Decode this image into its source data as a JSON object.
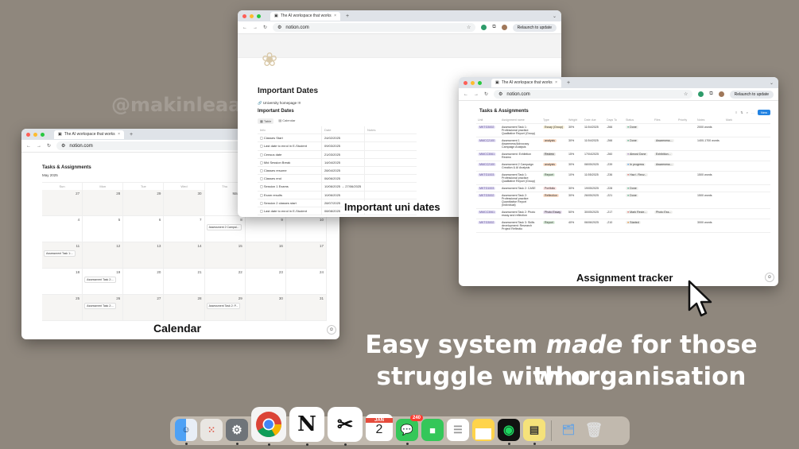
{
  "watermark": "@makinleaa",
  "browser": {
    "tab_title": "The AI workspace that works",
    "url": "notion.com",
    "relaunch": "Relaunch to update"
  },
  "calendar": {
    "title": "Tasks & Assignments",
    "month": "May 2025",
    "days": [
      "Sun",
      "Mon",
      "Tue",
      "Wed",
      "Thu",
      "Fri",
      "Sat"
    ],
    "cells": [
      {
        "n": "27",
        "dim": true,
        "ev": ""
      },
      {
        "n": "28",
        "dim": true,
        "ev": ""
      },
      {
        "n": "29",
        "dim": true,
        "ev": ""
      },
      {
        "n": "30",
        "dim": true,
        "ev": ""
      },
      {
        "n": "May 1",
        "dim": false,
        "ev": ""
      },
      {
        "n": "2",
        "dim": false,
        "ev": ""
      },
      {
        "n": "3",
        "dim": false,
        "ev": ""
      },
      {
        "n": "4",
        "dim": false,
        "ev": ""
      },
      {
        "n": "5",
        "dim": false,
        "ev": ""
      },
      {
        "n": "6",
        "dim": false,
        "ev": ""
      },
      {
        "n": "7",
        "dim": false,
        "ev": ""
      },
      {
        "n": "8",
        "dim": false,
        "ev": "Assessment 2 Campai..."
      },
      {
        "n": "9",
        "dim": false,
        "ev": ""
      },
      {
        "n": "10",
        "dim": false,
        "ev": ""
      },
      {
        "n": "11",
        "dim": true,
        "ev": "Assessment Task 1:..."
      },
      {
        "n": "12",
        "dim": true,
        "ev": ""
      },
      {
        "n": "13",
        "dim": true,
        "ev": ""
      },
      {
        "n": "14",
        "dim": true,
        "ev": ""
      },
      {
        "n": "15",
        "dim": true,
        "ev": ""
      },
      {
        "n": "16",
        "dim": true,
        "ev": ""
      },
      {
        "n": "17",
        "dim": true,
        "ev": ""
      },
      {
        "n": "18",
        "dim": false,
        "ev": ""
      },
      {
        "n": "19",
        "dim": false,
        "ev": "Assessment Task 2:..."
      },
      {
        "n": "20",
        "dim": false,
        "ev": ""
      },
      {
        "n": "21",
        "dim": false,
        "ev": ""
      },
      {
        "n": "22",
        "dim": false,
        "ev": ""
      },
      {
        "n": "23",
        "dim": false,
        "ev": ""
      },
      {
        "n": "24",
        "dim": false,
        "ev": ""
      },
      {
        "n": "25",
        "dim": true,
        "ev": ""
      },
      {
        "n": "26",
        "dim": true,
        "ev": "Assessment Task 2:..."
      },
      {
        "n": "27",
        "dim": true,
        "ev": ""
      },
      {
        "n": "28",
        "dim": true,
        "ev": ""
      },
      {
        "n": "29",
        "dim": true,
        "ev": "Assessment Task 2: P..."
      },
      {
        "n": "30",
        "dim": true,
        "ev": ""
      },
      {
        "n": "31",
        "dim": true,
        "ev": ""
      }
    ],
    "caption": "Calendar"
  },
  "dates": {
    "title": "Important Dates",
    "link": "University homepage !!!",
    "subtitle": "Important Dates",
    "tabs": [
      "Table",
      "Calendar"
    ],
    "columns": [
      "Info",
      "Date",
      "Notes"
    ],
    "rows": [
      [
        "Classes Start",
        "24/02/2025"
      ],
      [
        "Last date to enrol in E-Student",
        "09/03/2025"
      ],
      [
        "Census date",
        "21/03/2025"
      ],
      [
        "Mid Session Break",
        "14/04/2025"
      ],
      [
        "Classes resume",
        "28/04/2025"
      ],
      [
        "Classes end",
        "06/06/2025"
      ],
      [
        "Session 1 Exams",
        "10/06/2025 → 27/06/2025"
      ],
      [
        "Exam results",
        "10/06/2025"
      ],
      [
        "Session 2 classes start",
        "28/07/2025"
      ],
      [
        "Last date to enrol in E-Student",
        "08/08/2025"
      ]
    ],
    "caption": "Important uni dates"
  },
  "tasks": {
    "title": "Tasks & Assignments",
    "new_label": "New",
    "columns": [
      "Unit",
      "Assignment name",
      "Type",
      "Weight",
      "Date due",
      "Days To",
      "Status",
      "Files",
      "Priority",
      "Notes",
      "Mark"
    ],
    "rows": [
      {
        "unit": "MKTG3002",
        "name": "Assessment Task 1: Professional practice: Qualitative Report (Group)",
        "type": "Essay (Group)",
        "weight": "30%",
        "due": "11/04/2025",
        "days": "-266",
        "status": "Done",
        "files": "",
        "notes": "2000 words"
      },
      {
        "unit": "MMCC2100",
        "name": "Assessment 1 Awareness/Advocacy Campaign Analysis",
        "type": "analysis",
        "weight": "30%",
        "due": "11/04/2025",
        "days": "-266",
        "status": "Done",
        "files": "Awareness...",
        "notes": "1400-1700 words"
      },
      {
        "unit": "MMCC3061",
        "name": "Assessment: Exhibition Review",
        "type": "Review",
        "weight": "15%",
        "due": "17/04/2025",
        "days": "-260",
        "status": "Almost Done",
        "files": "Exhibition...",
        "notes": ""
      },
      {
        "unit": "MMCC2100",
        "name": "Assessment 2 Campaign Creation & AI Analysis",
        "type": "analysis",
        "weight": "30%",
        "due": "08/05/2025",
        "days": "-239",
        "status": "In progress",
        "files": "Awareness...",
        "notes": ""
      },
      {
        "unit": "MKTG1003",
        "name": "Assessment Task 1: Professional practice: Qualitative Report (Group)",
        "type": "Report",
        "weight": "10%",
        "due": "11/05/2025",
        "days": "-236",
        "status": "Hav i. Recv...",
        "files": "",
        "notes": "1500 words"
      },
      {
        "unit": "MKTG1003",
        "name": "Assessment Task 2: CASE",
        "type": "Portfolio",
        "weight": "30%",
        "due": "19/05/2025",
        "days": "-228",
        "status": "Done",
        "files": "",
        "notes": ""
      },
      {
        "unit": "MKTG3002",
        "name": "Assessment Task 2: Professional practice: Quantitative Report (Individual)",
        "type": "Reflection",
        "weight": "30%",
        "due": "26/05/2025",
        "days": "-221",
        "status": "Done",
        "files": "",
        "notes": "1500 words"
      },
      {
        "unit": "MMCC3061",
        "name": "Assessment Task 2: Photo essay and reflection",
        "type": "Photo Essay",
        "weight": "50%",
        "due": "30/05/2025",
        "days": "-217",
        "status": "Mark Recie...",
        "files": "Photo Ess...",
        "notes": ""
      },
      {
        "unit": "MKTG3002",
        "name": "Assessment Task 3: Skills development: Research Project Reflectio",
        "type": "Report",
        "weight": "40%",
        "due": "06/06/2025",
        "days": "-210",
        "status": "Started",
        "files": "",
        "notes": "3000 words"
      }
    ],
    "caption": "Assignment tracker"
  },
  "headline": {
    "line1_a": "Easy system ",
    "line1_em": "made",
    "line1_b": " for those who",
    "line2": "struggle with organisation"
  },
  "dock": {
    "calendar_month": "JAN",
    "calendar_day": "2",
    "messages_badge": "240"
  },
  "colors": {
    "background": "#8f877d",
    "accent": "#2383e2"
  }
}
